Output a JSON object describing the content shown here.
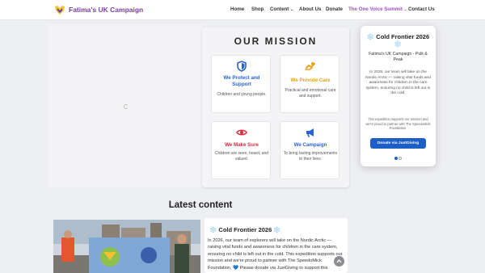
{
  "header": {
    "brand": "Fatima's UK Campaign",
    "nav": [
      {
        "label": "Home"
      },
      {
        "label": "Shop"
      },
      {
        "label": "Content"
      },
      {
        "label": "About Us"
      },
      {
        "label": "Donate"
      },
      {
        "label": "The One Voice Summit"
      },
      {
        "label": "Contact Us"
      }
    ]
  },
  "mission": {
    "title": "OUR MISSION",
    "cards": [
      {
        "title": "We Protect and Support",
        "desc": "Children and young people.",
        "color": "#2a63d8",
        "icon": "shield-icon"
      },
      {
        "title": "We Provide Care",
        "desc": "Practical and emotional care and support.",
        "color": "#e8a317",
        "icon": "care-icon"
      },
      {
        "title": "We Make Sure",
        "desc": "Children are seen, heard, and valued.",
        "color": "#e0263a",
        "icon": "eye-icon"
      },
      {
        "title": "We Campaign",
        "desc": "To bring lasting improvements to their lives.",
        "color": "#2a63d8",
        "icon": "megaphone-icon"
      }
    ]
  },
  "popup": {
    "title": "❄️ Cold Frontier 2026 ❄️",
    "subtitle": "Fatima's UK Campaign - Pulk & Peak",
    "body": "In 2026, our team will take on the Nordic Arctic — raising vital funds and awareness for children in the care system, ensuring no child is left out in the cold.",
    "note": "This expedition supports our mission and we're proud to partner with The SpeedoMick Foundation.",
    "button": "Donate via JustGiving"
  },
  "latest": {
    "heading": "Latest content",
    "article_title": "❄️ Cold Frontier 2026 ❄️",
    "article_body": "In 2026, our team of explorers will take on the Nordic Arctic — raising vital funds and awareness for children in the care system, ensuring no child is left out in the cold. This expedition supports our mission and we're proud to partner with The SpeedoMick Foundation. 💙 Please donate via JustGiving to support this"
  },
  "colors": {
    "accent": "#a04ed0",
    "brand": "#7b3fa6",
    "button": "#1c5fc7"
  }
}
